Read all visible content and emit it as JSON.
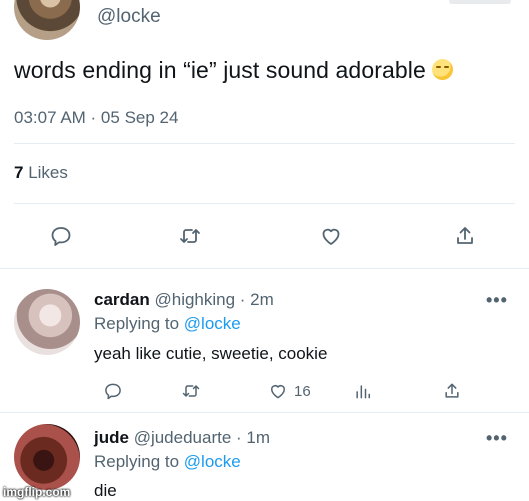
{
  "tweet": {
    "handle": "@locke",
    "text": "words ending in “ie” just sound adorable",
    "timestamp": "03:07 AM · 05 Sep 24",
    "likes_count": "7",
    "likes_label": " Likes"
  },
  "replies": [
    {
      "name": "cardan",
      "handle": "@highking",
      "time": " · 2m",
      "replying_prefix": "Replying to ",
      "replying_to": "@locke",
      "text": "yeah like cutie, sweetie, cookie",
      "like_count": "16"
    },
    {
      "name": "jude",
      "handle": "@judeduarte",
      "time": " · 1m",
      "replying_prefix": "Replying to ",
      "replying_to": "@locke",
      "text": "die"
    }
  ],
  "watermark": "imgflip.com",
  "more_symbol": "•••",
  "icons": [
    "reply-icon",
    "retweet-icon",
    "like-icon",
    "share-icon",
    "analytics-icon",
    "more-icon",
    "emoji-icon"
  ]
}
